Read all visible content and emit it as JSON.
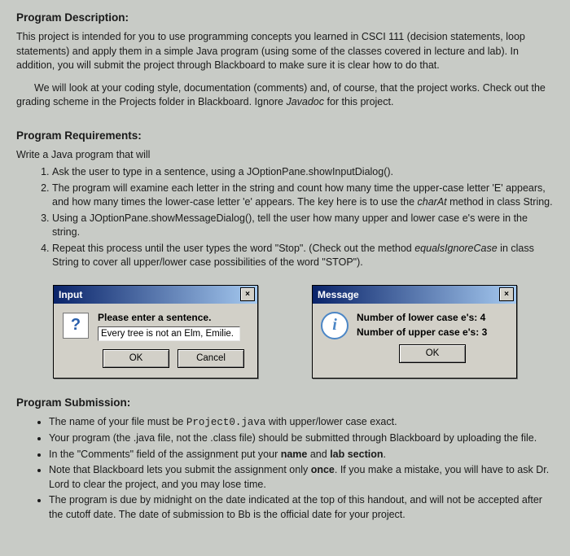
{
  "sections": {
    "desc_heading": "Program Description:",
    "desc_p1": "This project is intended for you to use programming concepts you learned in CSCI 111 (decision statements, loop statements) and apply them in a simple Java program (using some of the classes covered in lecture and lab). In addition, you will submit the project through Blackboard to make sure it is clear how to do that.",
    "desc_p2a": "We will look at your coding style, documentation (comments) and, of course, that the project works. Check out the grading scheme in the Projects folder in Blackboard. Ignore ",
    "desc_p2_ital": "Javadoc",
    "desc_p2b": " for this project.",
    "req_heading": "Program Requirements:",
    "req_intro": "Write a Java program that will",
    "reqs": {
      "1": "Ask the user to type in a sentence, using a JOptionPane.showInputDialog().",
      "2a": "The program will examine each letter in the string and count how many time the upper-case letter 'E' appears, and how many times the lower-case letter 'e' appears. The key here is to use the ",
      "2_ital": "charAt",
      "2b": " method in class String.",
      "3": "Using a JOptionPane.showMessageDialog(), tell the user how many upper and lower case e's were in the string.",
      "4a": "Repeat this process until the user types the word \"Stop\". (Check out the method ",
      "4_ital": "equalsIgnoreCase",
      "4b": " in class String to cover all upper/lower case possibilities of the word \"STOP\")."
    },
    "subm_heading": "Program Submission:",
    "subm": {
      "1a": "The name of your file must be ",
      "1_mono": "Project0.java",
      "1b": " with upper/lower case exact.",
      "2": "Your program (the .java file, not the .class file) should be submitted through Blackboard by uploading the file.",
      "3a": "In the \"Comments\" field of the assignment put your ",
      "3_b1": "name",
      "3_mid": " and ",
      "3_b2": "lab section",
      "3b": ".",
      "4a": "Note that Blackboard lets you submit the assignment only ",
      "4_bold": "once",
      "4b": ". If you make a mistake, you will have to ask Dr. Lord to clear the project, and you may lose time.",
      "5": "The program is due by midnight on the date indicated at the top of this handout, and will not be accepted after the cutoff date. The date of submission to Bb is the official date for your project."
    }
  },
  "input_dialog": {
    "title": "Input",
    "close": "×",
    "icon": "?",
    "prompt": "Please enter a sentence.",
    "value": "Every tree is not an Elm, Emilie.",
    "ok": "OK",
    "cancel": "Cancel"
  },
  "message_dialog": {
    "title": "Message",
    "close": "×",
    "icon": "i",
    "line1": "Number of lower case e's: 4",
    "line2": "Number of upper case e's: 3",
    "ok": "OK"
  }
}
